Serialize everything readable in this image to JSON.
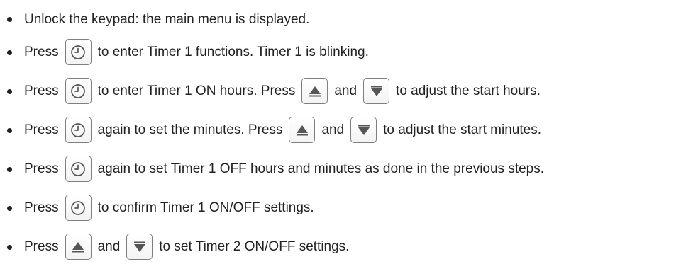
{
  "steps": [
    {
      "parts": [
        "Unlock the keypad: the main menu is displayed."
      ]
    },
    {
      "parts": [
        "Press",
        "to enter Timer 1 functions. Timer 1 is blinking."
      ]
    },
    {
      "parts": [
        "Press",
        "to enter Timer 1 ON hours. Press",
        "and",
        "to adjust the start hours."
      ]
    },
    {
      "parts": [
        "Press",
        "again to set the minutes. Press",
        "and",
        "to adjust the start minutes."
      ]
    },
    {
      "parts": [
        "Press",
        "again to set Timer 1 OFF hours and minutes as done in the previous steps."
      ]
    },
    {
      "parts": [
        "Press",
        "to confirm Timer 1 ON/OFF settings."
      ]
    },
    {
      "parts": [
        "Press",
        "and",
        "to set Timer 2 ON/OFF settings."
      ]
    }
  ],
  "icons": {
    "clock": "clock-icon",
    "up": "up-arrow-icon",
    "down": "down-arrow-icon"
  },
  "colors": {
    "text": "#222222",
    "key_border": "#7f7f7f",
    "arrow": "#555555"
  }
}
